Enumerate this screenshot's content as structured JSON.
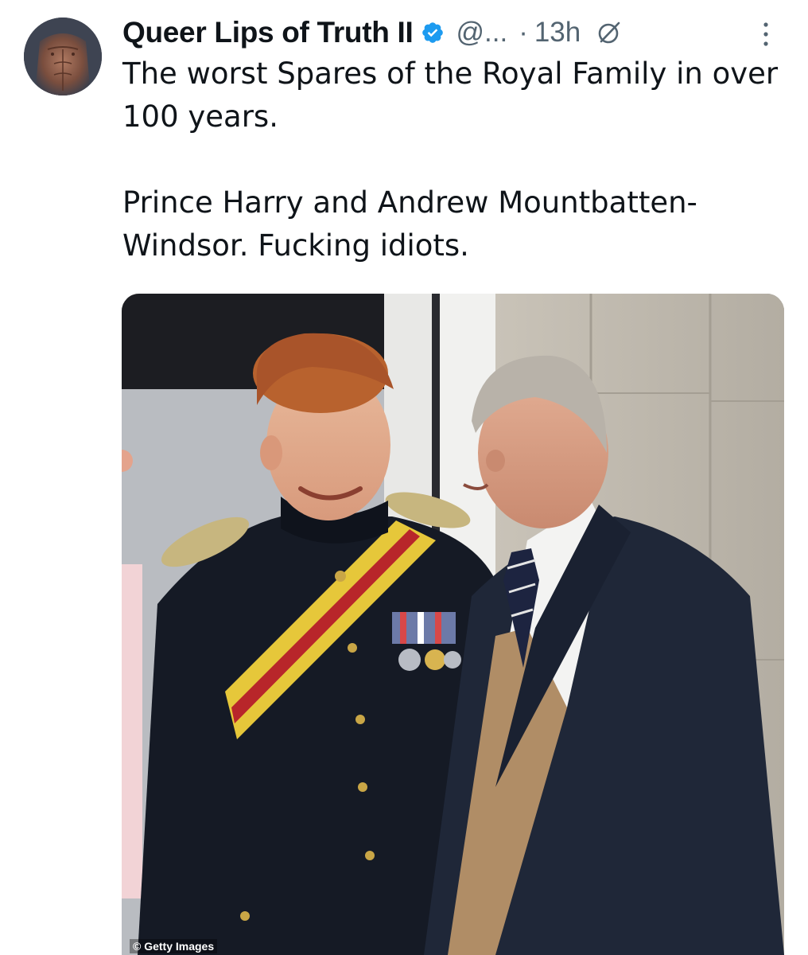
{
  "author": {
    "display_name": "Queer Lips of Truth II",
    "handle": "@...",
    "separator": "·",
    "time": "13h",
    "verified": true
  },
  "icons": {
    "verified": "verified-badge-icon",
    "grok": "grok-icon",
    "more": "more-options-icon"
  },
  "tweet": {
    "text_line_1": "The worst Spares of the Royal Family in over 100 years.",
    "text_line_2": "Prince Harry and Andrew Mountbatten-Windsor.  Fucking idiots."
  },
  "media": {
    "watermark": "© Getty Images"
  },
  "colors": {
    "verified_blue": "#1d9bf0",
    "secondary_text": "#536471",
    "primary_text": "#0f1419"
  }
}
